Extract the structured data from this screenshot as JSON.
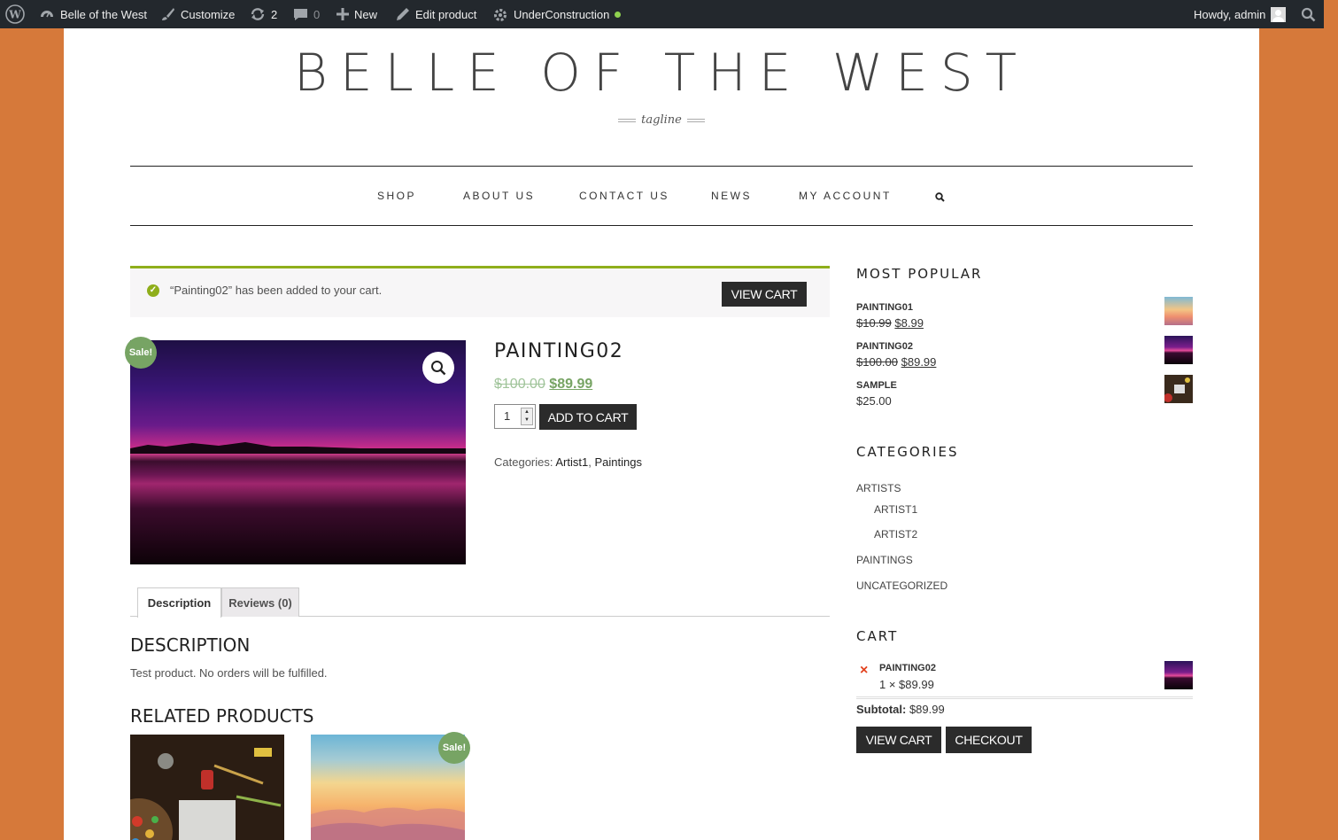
{
  "colors": {
    "background": "#d6793a",
    "admin_bar": "#23282d",
    "sale_badge": "#77a464",
    "notice_border": "#8fae1b",
    "button": "#2b2b2b"
  },
  "admin_bar": {
    "site": "Belle of the West",
    "customize": "Customize",
    "updates_count": "2",
    "comments_count": "0",
    "new": "New",
    "edit": "Edit product",
    "maintenance": "UnderConstruction",
    "howdy": "Howdy, admin"
  },
  "site": {
    "title": "BELLE OF THE WEST",
    "tagline": "tagline"
  },
  "nav": {
    "items": [
      "SHOP",
      "ABOUT US",
      "CONTACT US",
      "NEWS",
      "MY ACCOUNT"
    ]
  },
  "notice": {
    "message": "“Painting02” has been added to your cart.",
    "button": "VIEW CART"
  },
  "product": {
    "title": "PAINTING02",
    "sale_badge": "Sale!",
    "old_price": "$100.00",
    "price": "$89.99",
    "quantity": "1",
    "add_to_cart": "ADD TO CART",
    "categories_label": "Categories:",
    "categories": [
      "Artist1",
      "Paintings"
    ]
  },
  "tabs": [
    "Description",
    "Reviews (0)"
  ],
  "description": {
    "heading": "DESCRIPTION",
    "text": "Test product. No orders will be fulfilled."
  },
  "related": {
    "heading": "RELATED PRODUCTS",
    "sale_badge": "Sale!"
  },
  "sidebar": {
    "popular_heading": "MOST POPULAR",
    "popular": [
      {
        "name": "PAINTING01",
        "old_price": "$10.99",
        "price": "$8.99"
      },
      {
        "name": "PAINTING02",
        "old_price": "$100.00",
        "price": "$89.99"
      },
      {
        "name": "SAMPLE",
        "price": "$25.00"
      }
    ],
    "categories_heading": "CATEGORIES",
    "categories": [
      "ARTISTS",
      "ARTIST1",
      "ARTIST2",
      "PAINTINGS",
      "UNCATEGORIZED"
    ],
    "cart_heading": "CART",
    "cart_item": {
      "remove": "×",
      "name": "PAINTING02",
      "qty_price": "1 × $89.99"
    },
    "subtotal_label": "Subtotal:",
    "subtotal": "$89.99",
    "view_cart": "VIEW CART",
    "checkout": "CHECKOUT"
  }
}
